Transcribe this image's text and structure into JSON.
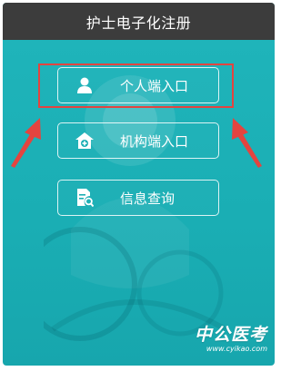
{
  "header": {
    "title": "护士电子化注册"
  },
  "menu": {
    "personal": {
      "label": "个人端入口",
      "icon": "person-icon"
    },
    "institution": {
      "label": "机构端入口",
      "icon": "house-plus-icon"
    },
    "query": {
      "label": "信息查询",
      "icon": "doc-search-icon"
    }
  },
  "logo": {
    "text": "中公医考",
    "url": "www.cyikao.com"
  },
  "colors": {
    "panel": "#1aaeb4",
    "titlebar": "#3c3c3c",
    "highlight": "#e4443f",
    "arrow": "#e4443f"
  }
}
